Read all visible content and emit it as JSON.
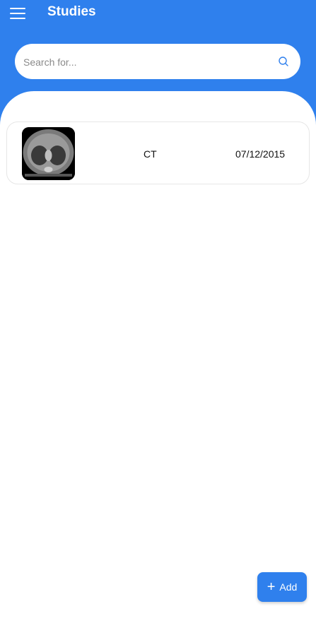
{
  "header": {
    "title": "Studies",
    "menu_icon": "menu-icon"
  },
  "search": {
    "placeholder": "Search for...",
    "icon": "search-icon"
  },
  "studies": [
    {
      "thumbnail": "ct-scan-thumbnail",
      "modality": "CT",
      "date": "07/12/2015"
    }
  ],
  "fab": {
    "icon": "plus-icon",
    "label": "Add"
  },
  "colors": {
    "primary": "#2f80ed",
    "background": "#ffffff",
    "text": "#111111"
  }
}
